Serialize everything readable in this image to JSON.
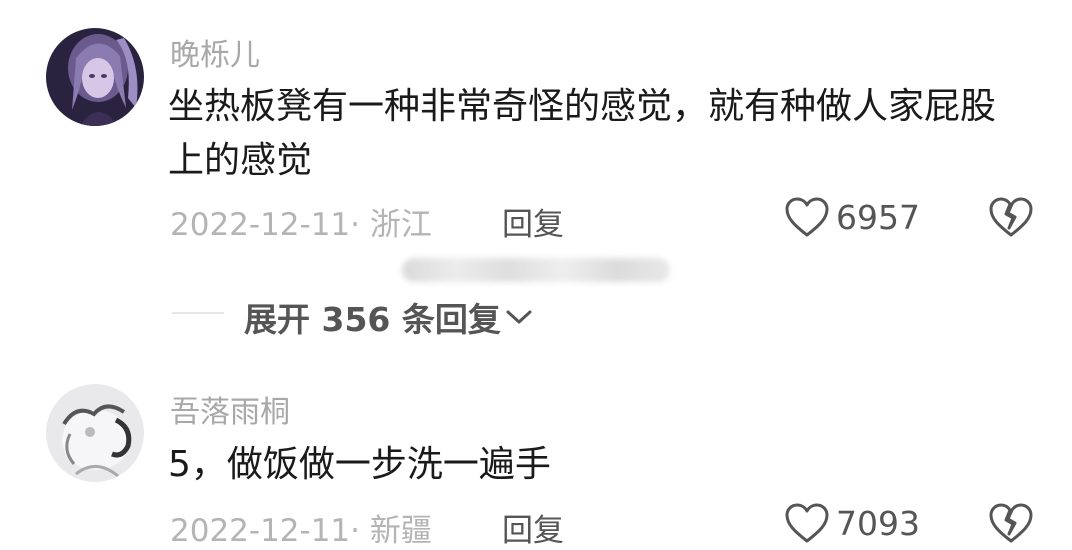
{
  "comments": [
    {
      "username": "晚栎儿",
      "content": "坐热板凳有一种非常奇怪的感觉，就有种做人家屁股上的感觉",
      "date_location": "2022-12-11· 浙江",
      "reply_label": "回复",
      "like_count": "6957",
      "avatar_icon": "anime-girl-avatar"
    },
    {
      "username": "吾落雨桐",
      "content": "5，做饭做一步洗一遍手",
      "date_location": "2022-12-11· 新疆",
      "reply_label": "回复",
      "like_count": "7093",
      "avatar_icon": "sketch-avatar"
    }
  ],
  "expand_replies": {
    "label": "展开 356 条回复"
  }
}
